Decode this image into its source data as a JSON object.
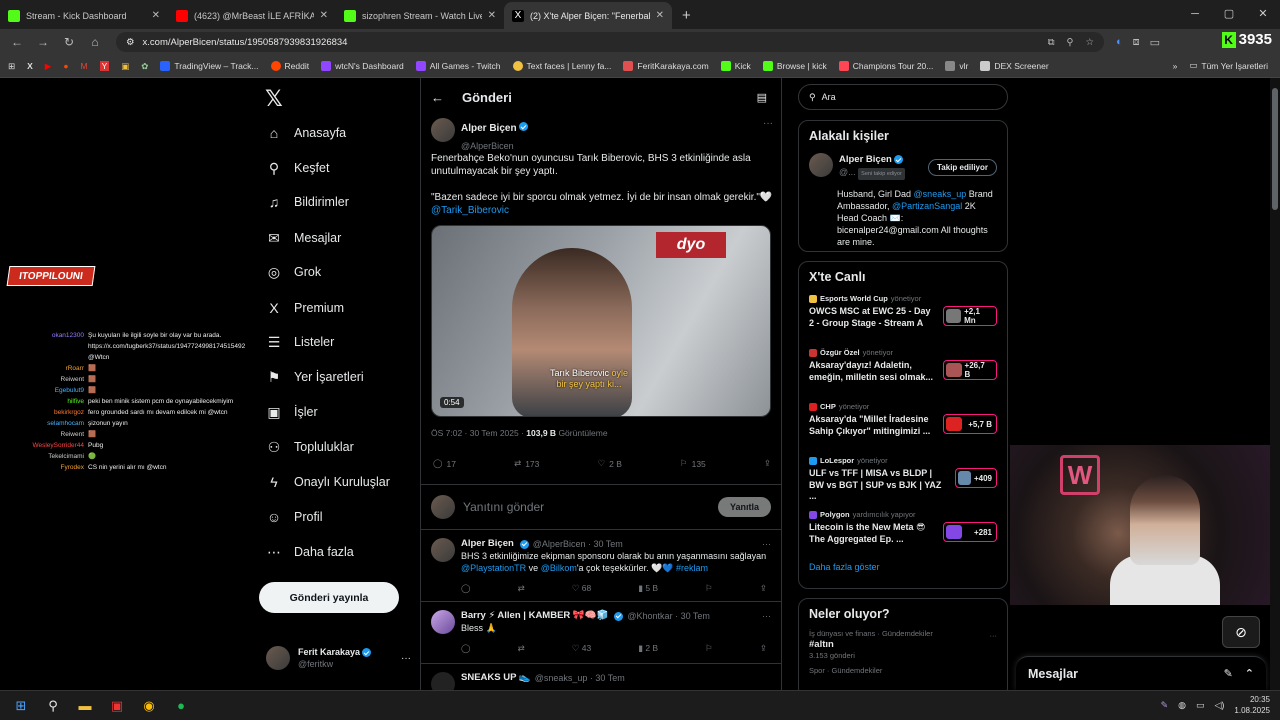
{
  "browser": {
    "tabs": [
      {
        "title": "Stream - Kick Dashboard",
        "color": "#53fc18",
        "active": false
      },
      {
        "title": "(4623) @MrBeast İLE AFRİKA'D",
        "color": "#ff0000",
        "active": false
      },
      {
        "title": "sizophren Stream - Watch Live",
        "color": "#53fc18",
        "active": false
      },
      {
        "title": "(2) X'te Alper Biçen: \"Fenerbahç",
        "color": "#ffffff",
        "active": true
      }
    ],
    "new_tab": "+",
    "url": "x.com/AlperBicen/status/1950587939831926834",
    "kick_count": "3935",
    "bookmarks": [
      {
        "label": "TradingView – Track...",
        "color": "#2962ff"
      },
      {
        "label": "Reddit",
        "color": "#ff4500"
      },
      {
        "label": "wtcN's Dashboard",
        "color": "#9146ff"
      },
      {
        "label": "All Games - Twitch",
        "color": "#9146ff"
      },
      {
        "label": "Text faces | Lenny fa...",
        "color": "#f0c040"
      },
      {
        "label": "FeritKarakaya.com",
        "color": "#e05050"
      },
      {
        "label": "Kick",
        "color": "#53fc18"
      },
      {
        "label": "Browse | kick",
        "color": "#53fc18"
      },
      {
        "label": "Champions Tour 20...",
        "color": "#ff4655"
      },
      {
        "label": "vlr",
        "color": "#888888"
      },
      {
        "label": "DEX Screener",
        "color": "#cccccc"
      }
    ],
    "bookmarks_all": "Tüm Yer İşaretleri"
  },
  "overlay": {
    "logo_text": "ITOPPILOUNI",
    "chat": [
      {
        "user": "okan12300",
        "color": "#9b7bff",
        "msg": "Şu kuyuları ile ilgili soyle bir olay var bu arada. https://x.com/tugberk37/status/1947724998174515492 @Wtcn"
      },
      {
        "user": "rRoarr",
        "color": "#f0a030",
        "msg": "🟫"
      },
      {
        "user": "Reiwent",
        "color": "#cccccc",
        "msg": "🟫"
      },
      {
        "user": "Egebulut9",
        "color": "#4ab3ff",
        "msg": "🟫"
      },
      {
        "user": "hilfive",
        "color": "#53fc18",
        "msg": "peki ben minik sistem pcm de oynayabilecekmiyim"
      },
      {
        "user": "bekirkrgoz",
        "color": "#ff7a30",
        "msg": "fero grounded sardı mı devam edilcek mi @wtcn"
      },
      {
        "user": "selamhocam",
        "color": "#4ab3ff",
        "msg": "şizonun yayın"
      },
      {
        "user": "Reiwent",
        "color": "#cccccc",
        "msg": "🟫"
      },
      {
        "user": "WesleySorrider44",
        "color": "#ff4444",
        "msg": "Pubg"
      },
      {
        "user": "Tekelcimami",
        "color": "#cccccc",
        "msg": "🟢"
      },
      {
        "user": "Fyrodex",
        "color": "#f0a030",
        "msg": "CS nin yerini alır mı @wtcn"
      }
    ]
  },
  "nav": {
    "items": [
      {
        "label": "Anasayfa",
        "icon": "⌂"
      },
      {
        "label": "Keşfet",
        "icon": "⚲"
      },
      {
        "label": "Bildirimler",
        "icon": "♫"
      },
      {
        "label": "Mesajlar",
        "icon": "✉"
      },
      {
        "label": "Grok",
        "icon": "◎"
      },
      {
        "label": "Premium",
        "icon": "X"
      },
      {
        "label": "Listeler",
        "icon": "☰"
      },
      {
        "label": "Yer İşaretleri",
        "icon": "⚑"
      },
      {
        "label": "İşler",
        "icon": "▣"
      },
      {
        "label": "Topluluklar",
        "icon": "⚇"
      },
      {
        "label": "Onaylı Kuruluşlar",
        "icon": "ϟ"
      },
      {
        "label": "Profil",
        "icon": "☺"
      },
      {
        "label": "Daha fazla",
        "icon": "⋯"
      }
    ],
    "post_button": "Gönderi yayınla",
    "account_name": "Ferit Karakaya",
    "account_handle": "@feritkw"
  },
  "post": {
    "header": "Gönderi",
    "author": "Alper Biçen",
    "handle": "@AlperBicen",
    "text1": "Fenerbahçe Beko'nun oyuncusu Tarık Biberovic, BHS 3 etkinliğinde asla unutulmayacak bir şey yaptı.",
    "text2": "\"Bazen sadece iyi bir sporcu olmak yetmez. İyi de bir insan olmak gerekir.\"🤍 ",
    "mention": "@Tarik_Biberovic",
    "video_brand": "dyo",
    "caption1": "Tarık Biberovic ",
    "caption1_yellow": "öyle",
    "caption2": "bir şey yaptı ki...",
    "duration": "0:54",
    "time": "ÖS 7:02 · 30 Tem 2025 · ",
    "views": "103,9 B",
    "views_label": " Görüntüleme",
    "replies": "17",
    "reposts": "173",
    "likes": "2 B",
    "bookmarks": "135",
    "reply_placeholder": "Yanıtını gönder",
    "reply_button": "Yanıtla"
  },
  "replies": [
    {
      "name": "Alper Biçen",
      "handle": "@AlperBicen · 30 Tem",
      "text": "BHS 3 etkinliğimize ekipman sponsoru olarak bu anın yaşanmasını sağlayan ",
      "link1": "@PlaystationTR",
      "mid": " ve ",
      "link2": "@Bilkom",
      "tail": "'a çok teşekkürler. 🤍💙 ",
      "link3": "#reklam",
      "r": "",
      "rt": "",
      "l": "68",
      "v": "5 B"
    },
    {
      "name": "Barry ⚡ Allen | KAMBER 🎀🧠🧊",
      "handle": "@Khontkar · 30 Tem",
      "text": "Bless 🙏",
      "r": "",
      "rt": "",
      "l": "43",
      "v": "2 B"
    },
    {
      "name": "SNEAKS UP 👟",
      "handle": "@sneaks_up · 30 Tem"
    }
  ],
  "sidebar": {
    "search_placeholder": "Ara",
    "related_title": "Alakalı kişiler",
    "related_name": "Alper Biçen",
    "related_handle": "@...",
    "related_tag": "Seni takip ediyor",
    "follow_button": "Takip ediliyor",
    "bio_pre": "Husband, Girl Dad ",
    "bio_link1": "@sneaks_up",
    "bio_mid": " Brand Ambassador, ",
    "bio_link2": "@PartizanSangal",
    "bio_post": " 2K Head Coach ✉️: bicenalper24@gmail.com All thoughts are mine.",
    "live_title": "X'te Canlı",
    "live": [
      {
        "src": "Esports World Cup",
        "role": "yönetiyor",
        "title": "OWCS MSC at EWC 25 - Day 2 - Group Stage - Stream A",
        "count": "+2,1 Mn",
        "color": "#f0c040"
      },
      {
        "src": "Özgür Özel",
        "role": "yönetiyor",
        "title": "Aksaray'dayız! Adaletin, emeğin, milletin sesi olmak...",
        "count": "+26,7 B",
        "color": "#cc3333"
      },
      {
        "src": "CHP",
        "role": "yönetiyor",
        "title": "Aksaray'da \"Millet İradesine Sahip Çıkıyor\" mitingimizi ...",
        "count": "+5,7 B",
        "color": "#e02020"
      },
      {
        "src": "LoLespor",
        "role": "yönetiyor",
        "title": "ULF vs TFF | MISA vs BLDP | BW vs BGT | SUP vs BJK | YAZ ...",
        "count": "+409",
        "color": "#1d9bf0"
      },
      {
        "src": "Polygon",
        "role": "yardımcılık yapıyor",
        "title": "Litecoin is the New Meta 😎 The Aggregated Ep. ...",
        "count": "+281",
        "color": "#8247e5"
      }
    ],
    "show_more": "Daha fazla göster",
    "happening_title": "Neler oluyor?",
    "trend_cat": "İş dünyası ve finans · Gündemdekiler",
    "trend_name": "#altın",
    "trend_posts": "3.153 gönderi",
    "trend2_cat": "Spor · Gündemdekiler"
  },
  "dm": {
    "label": "Mesajlar"
  },
  "taskbar": {
    "time": "20:35",
    "date": "1.08.2025"
  }
}
